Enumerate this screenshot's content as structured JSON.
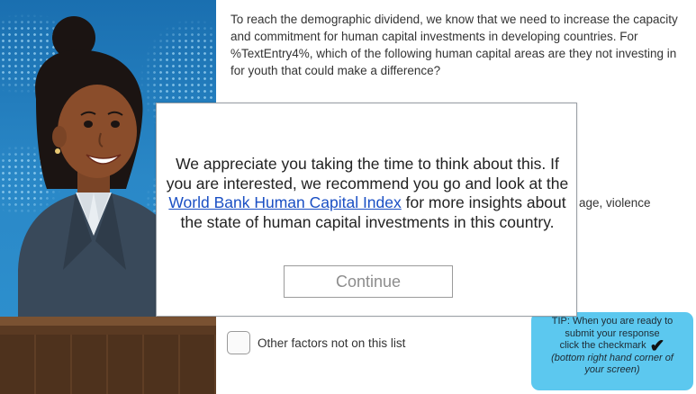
{
  "question": {
    "text": "To reach the demographic dividend, we know that we need to increase the capacity and commitment for human capital investments in developing countries. For %TextEntry4%, which of the following human capital areas are they not investing in for youth that could make a difference?"
  },
  "background_option_partial": "age, violence",
  "options": [
    {
      "label": "Other factors not on this list",
      "checked": false
    }
  ],
  "tip": {
    "line1": "TIP: When you are ready to",
    "line2": "submit your response",
    "line3": "click the checkmark",
    "check_glyph": "✔",
    "line4": "(bottom right hand corner of",
    "line5": "your screen)"
  },
  "modal": {
    "message_before": "We appreciate you taking the time to think about this. If you are interested, we recommend you go and look at the ",
    "link_text": "World Bank Human Capital Index",
    "message_after": " for more insights about the state of human capital investments in this country.",
    "continue_label": "Continue"
  },
  "colors": {
    "tip_background": "#5cc8ef",
    "link": "#1a4fc4",
    "scene_background": "#1e6aa4"
  },
  "icons": {
    "tip_icon": "checkmark-icon"
  }
}
